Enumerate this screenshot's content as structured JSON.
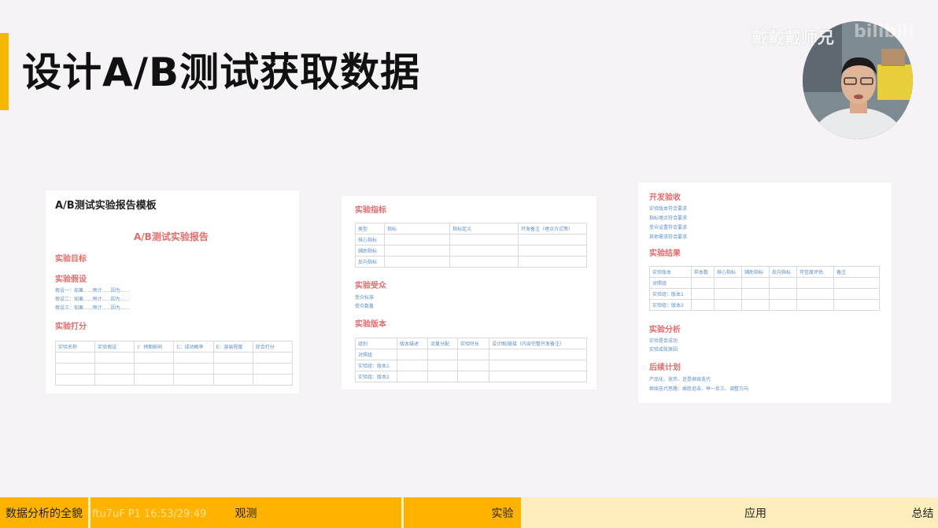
{
  "slide": {
    "title": "设计A/B测试获取数据",
    "watermark": "戴戴戴师兄",
    "watermark_logo": "bilibili",
    "accent_color": "#f5b800"
  },
  "card1": {
    "heading": "A/B测试实验报告模板",
    "report_title": "A/B测试实验报告",
    "section_goal": "实验目标",
    "section_hypothesis": "实验假设",
    "hypotheses": [
      "假设一：如果......预计......因为......",
      "假设二：如果......预计......因为......",
      "假设三：如果......预计......因为......"
    ],
    "section_score": "实验打分",
    "score_headers": [
      "实验名称",
      "实验假设",
      "I：预期影响",
      "C：成功概率",
      "E：容易程度",
      "综合打分"
    ]
  },
  "card2": {
    "section_metrics": "实验指标",
    "metric_headers": [
      "类型",
      "指标",
      "指标定义",
      "开发备注（埋点方式等）"
    ],
    "metric_rows": [
      "核心指标",
      "辅助指标",
      "反向指标"
    ],
    "section_audience": "实验受众",
    "audience_lines": [
      "受众标准",
      "受众数量"
    ],
    "section_version": "实验版本",
    "version_headers": [
      "组别",
      "版本描述",
      "流量分配",
      "实验时长",
      "设计图/链接（内含完整开发备注）"
    ],
    "version_rows": [
      "对照组",
      "实验组：版本1",
      "实验组：版本2"
    ]
  },
  "card3": {
    "section_acceptance": "开发验收",
    "acceptance_lines": [
      "实验版本符合要求",
      "指标埋点符合要求",
      "受众设置符合要求",
      "其他需求符合要求"
    ],
    "section_result": "实验结果",
    "result_headers": [
      "实验版本",
      "样本数",
      "核心指标",
      "辅助指标",
      "反向指标",
      "可信度评估",
      "备注"
    ],
    "result_rows": [
      "对照组",
      "实验组：版本1",
      "实验组：版本2"
    ],
    "section_analysis": "实验分析",
    "analysis_lines": [
      "实验是否成功",
      "实验成败原因"
    ],
    "section_plan": "后续计划",
    "plan_lines": [
      "产品化、放弃、还是继续迭代",
      "继续迭代思路：乘胜追击、举一反三、调整方向"
    ]
  },
  "progress": {
    "chapters": [
      "数据分析的全貌",
      "观测",
      "实验",
      "应用",
      "总结"
    ],
    "timestamp": "ftu7uF P1 16:53/29:49",
    "current_chapter_progress": 0.27
  }
}
